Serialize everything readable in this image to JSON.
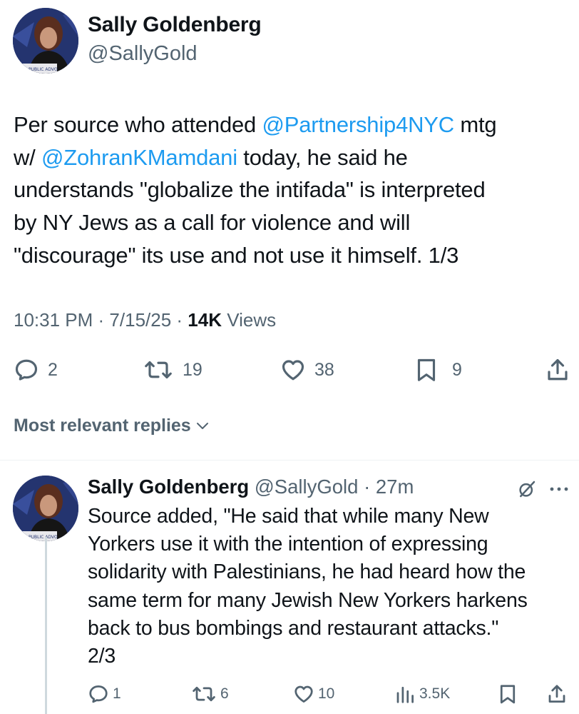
{
  "main_tweet": {
    "author_name": "Sally Goldenberg",
    "author_handle": "@SallyGold",
    "avatar_caption": "PUBLIC ADVO",
    "body": {
      "t1": "Per source who attended ",
      "m1": "@Partnership4NYC",
      "t2": " mtg",
      "t3": "w/ ",
      "m2": "@ZohranKMamdani",
      "t4": " today, he said he",
      "l3": "understands \"globalize the intifada\" is interpreted",
      "l4": "by NY Jews as a call for violence and will",
      "l5": "\"discourage\" its use and not use it himself. 1/3"
    },
    "time": "10:31 PM",
    "date": "7/15/25",
    "views_count": "14K",
    "views_label": "Views",
    "actions": {
      "replies": "2",
      "reposts": "19",
      "likes": "38",
      "bookmarks": "9"
    }
  },
  "replies_sort": {
    "label": "Most relevant replies"
  },
  "reply": {
    "author_name": "Sally Goldenberg",
    "author_handle": "@SallyGold",
    "time_ago": "27m",
    "avatar_caption": "PUBLIC ADVO",
    "body_lines": [
      "Source added, \"He said that while many New",
      "Yorkers use it with the intention of expressing",
      "solidarity with Palestinians, he had heard how the",
      "same term for many Jewish New Yorkers harkens",
      "back to bus bombings and restaurant attacks.\"",
      "2/3"
    ],
    "actions": {
      "replies": "1",
      "reposts": "6",
      "likes": "10",
      "views": "3.5K"
    }
  },
  "colors": {
    "text": "#0f1419",
    "secondary": "#536471",
    "link": "#1d9bf0",
    "divider": "#eff3f4"
  },
  "icons": {
    "reply": "speech-bubble-icon",
    "repost": "repost-arrows-icon",
    "like": "heart-icon",
    "bookmark": "bookmark-icon",
    "share": "share-upload-icon",
    "views": "bar-chart-icon",
    "grok": "grok-slash-circle-icon",
    "more": "three-dots-icon",
    "sort": "chevron-down-icon"
  }
}
